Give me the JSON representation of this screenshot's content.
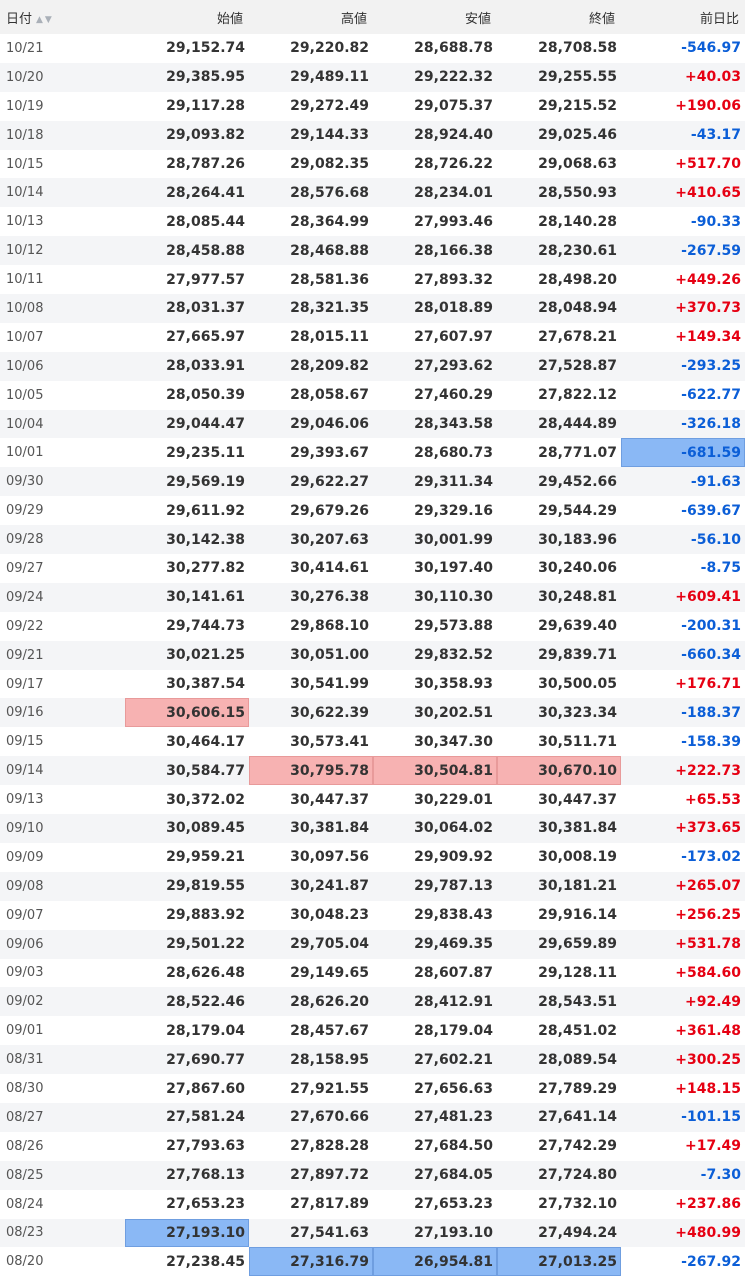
{
  "header": {
    "date": "日付",
    "sort_icons": "▲▼",
    "open": "始値",
    "high": "高値",
    "low": "安値",
    "close": "終値",
    "change": "前日比"
  },
  "colors": {
    "positive": "#e60012",
    "negative": "#0b5ed7",
    "highlight_red": "#f7b2b2",
    "highlight_blue": "#8ab8f5"
  },
  "rows": [
    {
      "date": "10/21",
      "open": "29,152.74",
      "high": "29,220.82",
      "low": "28,688.78",
      "close": "28,708.58",
      "change": "-546.97"
    },
    {
      "date": "10/20",
      "open": "29,385.95",
      "high": "29,489.11",
      "low": "29,222.32",
      "close": "29,255.55",
      "change": "+40.03"
    },
    {
      "date": "10/19",
      "open": "29,117.28",
      "high": "29,272.49",
      "low": "29,075.37",
      "close": "29,215.52",
      "change": "+190.06"
    },
    {
      "date": "10/18",
      "open": "29,093.82",
      "high": "29,144.33",
      "low": "28,924.40",
      "close": "29,025.46",
      "change": "-43.17"
    },
    {
      "date": "10/15",
      "open": "28,787.26",
      "high": "29,082.35",
      "low": "28,726.22",
      "close": "29,068.63",
      "change": "+517.70"
    },
    {
      "date": "10/14",
      "open": "28,264.41",
      "high": "28,576.68",
      "low": "28,234.01",
      "close": "28,550.93",
      "change": "+410.65"
    },
    {
      "date": "10/13",
      "open": "28,085.44",
      "high": "28,364.99",
      "low": "27,993.46",
      "close": "28,140.28",
      "change": "-90.33"
    },
    {
      "date": "10/12",
      "open": "28,458.88",
      "high": "28,468.88",
      "low": "28,166.38",
      "close": "28,230.61",
      "change": "-267.59"
    },
    {
      "date": "10/11",
      "open": "27,977.57",
      "high": "28,581.36",
      "low": "27,893.32",
      "close": "28,498.20",
      "change": "+449.26"
    },
    {
      "date": "10/08",
      "open": "28,031.37",
      "high": "28,321.35",
      "low": "28,018.89",
      "close": "28,048.94",
      "change": "+370.73"
    },
    {
      "date": "10/07",
      "open": "27,665.97",
      "high": "28,015.11",
      "low": "27,607.97",
      "close": "27,678.21",
      "change": "+149.34"
    },
    {
      "date": "10/06",
      "open": "28,033.91",
      "high": "28,209.82",
      "low": "27,293.62",
      "close": "27,528.87",
      "change": "-293.25"
    },
    {
      "date": "10/05",
      "open": "28,050.39",
      "high": "28,058.67",
      "low": "27,460.29",
      "close": "27,822.12",
      "change": "-622.77"
    },
    {
      "date": "10/04",
      "open": "29,044.47",
      "high": "29,046.06",
      "low": "28,343.58",
      "close": "28,444.89",
      "change": "-326.18"
    },
    {
      "date": "10/01",
      "open": "29,235.11",
      "high": "29,393.67",
      "low": "28,680.73",
      "close": "28,771.07",
      "change": "-681.59",
      "hl": {
        "change": "blue"
      }
    },
    {
      "date": "09/30",
      "open": "29,569.19",
      "high": "29,622.27",
      "low": "29,311.34",
      "close": "29,452.66",
      "change": "-91.63"
    },
    {
      "date": "09/29",
      "open": "29,611.92",
      "high": "29,679.26",
      "low": "29,329.16",
      "close": "29,544.29",
      "change": "-639.67"
    },
    {
      "date": "09/28",
      "open": "30,142.38",
      "high": "30,207.63",
      "low": "30,001.99",
      "close": "30,183.96",
      "change": "-56.10"
    },
    {
      "date": "09/27",
      "open": "30,277.82",
      "high": "30,414.61",
      "low": "30,197.40",
      "close": "30,240.06",
      "change": "-8.75"
    },
    {
      "date": "09/24",
      "open": "30,141.61",
      "high": "30,276.38",
      "low": "30,110.30",
      "close": "30,248.81",
      "change": "+609.41"
    },
    {
      "date": "09/22",
      "open": "29,744.73",
      "high": "29,868.10",
      "low": "29,573.88",
      "close": "29,639.40",
      "change": "-200.31"
    },
    {
      "date": "09/21",
      "open": "30,021.25",
      "high": "30,051.00",
      "low": "29,832.52",
      "close": "29,839.71",
      "change": "-660.34"
    },
    {
      "date": "09/17",
      "open": "30,387.54",
      "high": "30,541.99",
      "low": "30,358.93",
      "close": "30,500.05",
      "change": "+176.71"
    },
    {
      "date": "09/16",
      "open": "30,606.15",
      "high": "30,622.39",
      "low": "30,202.51",
      "close": "30,323.34",
      "change": "-188.37",
      "hl": {
        "open": "red"
      }
    },
    {
      "date": "09/15",
      "open": "30,464.17",
      "high": "30,573.41",
      "low": "30,347.30",
      "close": "30,511.71",
      "change": "-158.39"
    },
    {
      "date": "09/14",
      "open": "30,584.77",
      "high": "30,795.78",
      "low": "30,504.81",
      "close": "30,670.10",
      "change": "+222.73",
      "hl": {
        "high": "red",
        "low": "red",
        "close": "red"
      }
    },
    {
      "date": "09/13",
      "open": "30,372.02",
      "high": "30,447.37",
      "low": "30,229.01",
      "close": "30,447.37",
      "change": "+65.53"
    },
    {
      "date": "09/10",
      "open": "30,089.45",
      "high": "30,381.84",
      "low": "30,064.02",
      "close": "30,381.84",
      "change": "+373.65"
    },
    {
      "date": "09/09",
      "open": "29,959.21",
      "high": "30,097.56",
      "low": "29,909.92",
      "close": "30,008.19",
      "change": "-173.02"
    },
    {
      "date": "09/08",
      "open": "29,819.55",
      "high": "30,241.87",
      "low": "29,787.13",
      "close": "30,181.21",
      "change": "+265.07"
    },
    {
      "date": "09/07",
      "open": "29,883.92",
      "high": "30,048.23",
      "low": "29,838.43",
      "close": "29,916.14",
      "change": "+256.25"
    },
    {
      "date": "09/06",
      "open": "29,501.22",
      "high": "29,705.04",
      "low": "29,469.35",
      "close": "29,659.89",
      "change": "+531.78"
    },
    {
      "date": "09/03",
      "open": "28,626.48",
      "high": "29,149.65",
      "low": "28,607.87",
      "close": "29,128.11",
      "change": "+584.60"
    },
    {
      "date": "09/02",
      "open": "28,522.46",
      "high": "28,626.20",
      "low": "28,412.91",
      "close": "28,543.51",
      "change": "+92.49"
    },
    {
      "date": "09/01",
      "open": "28,179.04",
      "high": "28,457.67",
      "low": "28,179.04",
      "close": "28,451.02",
      "change": "+361.48"
    },
    {
      "date": "08/31",
      "open": "27,690.77",
      "high": "28,158.95",
      "low": "27,602.21",
      "close": "28,089.54",
      "change": "+300.25"
    },
    {
      "date": "08/30",
      "open": "27,867.60",
      "high": "27,921.55",
      "low": "27,656.63",
      "close": "27,789.29",
      "change": "+148.15"
    },
    {
      "date": "08/27",
      "open": "27,581.24",
      "high": "27,670.66",
      "low": "27,481.23",
      "close": "27,641.14",
      "change": "-101.15"
    },
    {
      "date": "08/26",
      "open": "27,793.63",
      "high": "27,828.28",
      "low": "27,684.50",
      "close": "27,742.29",
      "change": "+17.49"
    },
    {
      "date": "08/25",
      "open": "27,768.13",
      "high": "27,897.72",
      "low": "27,684.05",
      "close": "27,724.80",
      "change": "-7.30"
    },
    {
      "date": "08/24",
      "open": "27,653.23",
      "high": "27,817.89",
      "low": "27,653.23",
      "close": "27,732.10",
      "change": "+237.86"
    },
    {
      "date": "08/23",
      "open": "27,193.10",
      "high": "27,541.63",
      "low": "27,193.10",
      "close": "27,494.24",
      "change": "+480.99",
      "hl": {
        "open": "blue"
      }
    },
    {
      "date": "08/20",
      "open": "27,238.45",
      "high": "27,316.79",
      "low": "26,954.81",
      "close": "27,013.25",
      "change": "-267.92",
      "hl": {
        "high": "blue",
        "low": "blue",
        "close": "blue"
      }
    }
  ]
}
